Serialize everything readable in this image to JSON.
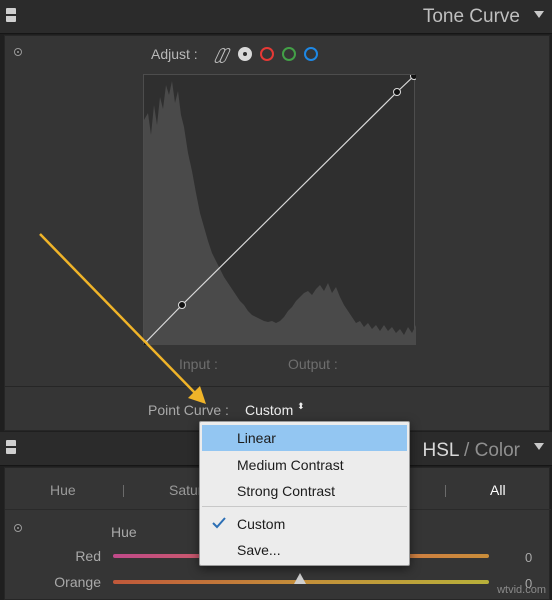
{
  "tone_curve": {
    "title": "Tone Curve",
    "adjust_label": "Adjust :",
    "channels": [
      "parametric-icon",
      "rgb-icon",
      "red-channel-icon",
      "green-channel-icon",
      "blue-channel-icon"
    ],
    "input_label": "Input :",
    "output_label": "Output :",
    "point_curve_label": "Point Curve :",
    "point_curve_value": "Custom",
    "stepper_glyph": "⬍"
  },
  "dropdown": {
    "items": [
      {
        "label": "Linear",
        "selected": true
      },
      {
        "label": "Medium Contrast"
      },
      {
        "label": "Strong Contrast"
      },
      {
        "label": "Custom",
        "checked": true
      },
      {
        "label": "Save..."
      }
    ]
  },
  "hsl": {
    "title_hsl": "HSL",
    "title_sep": "/",
    "title_color": "Color",
    "tabs": [
      "Hue",
      "Satur",
      "All"
    ],
    "section_label": "Hue",
    "sliders": [
      {
        "label": "Red",
        "value": "0"
      },
      {
        "label": "Orange",
        "value": "0"
      }
    ]
  },
  "watermark": "wtvid.com",
  "colors": {
    "accent_arrow": "#f0b429",
    "menu_highlight": "#93c6f2",
    "channel_red": "#e53935",
    "channel_green": "#43a047",
    "channel_blue": "#1e88e5"
  }
}
